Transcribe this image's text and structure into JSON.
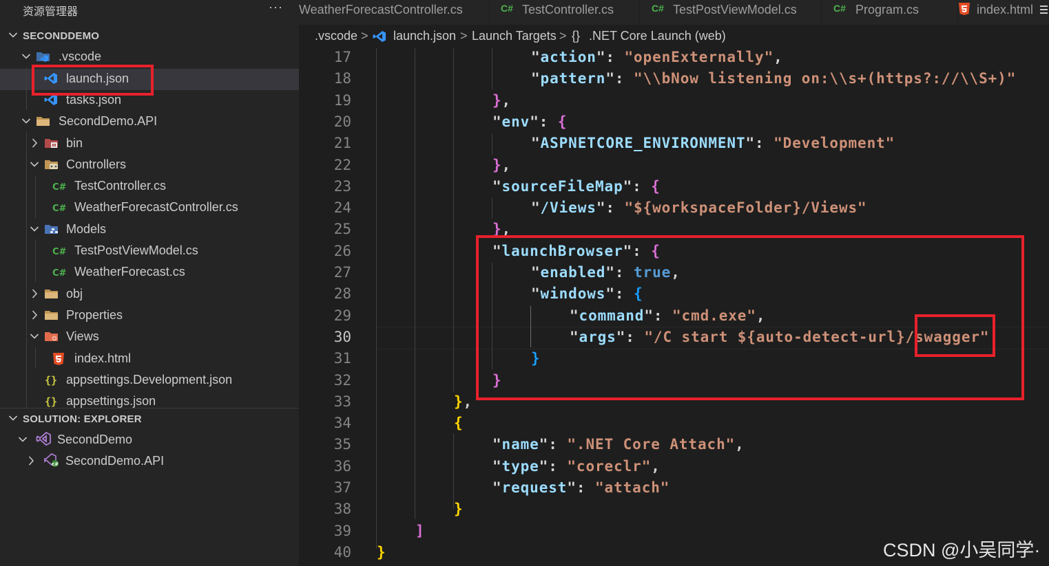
{
  "explorer": {
    "title": "资源管理器",
    "more": "···",
    "project_section": "SECONDDEMO",
    "tree": [
      {
        "label": ".vscode",
        "icon": "vscode-folder-icon",
        "expanded": true,
        "level": 1,
        "type": "folder"
      },
      {
        "label": "launch.json",
        "icon": "vscode-json-icon",
        "level": 2,
        "type": "file",
        "selected": true
      },
      {
        "label": "tasks.json",
        "icon": "vscode-json-icon",
        "level": 2,
        "type": "file"
      },
      {
        "label": "SecondDemo.API",
        "icon": "folder-icon",
        "expanded": true,
        "level": 1,
        "type": "folder"
      },
      {
        "label": "bin",
        "icon": "bin-folder-icon",
        "expanded": false,
        "level": 2,
        "type": "folder"
      },
      {
        "label": "Controllers",
        "icon": "controllers-folder-icon",
        "expanded": true,
        "level": 2,
        "type": "folder"
      },
      {
        "label": "TestController.cs",
        "icon": "csharp-icon",
        "level": 3,
        "type": "file"
      },
      {
        "label": "WeatherForecastController.cs",
        "icon": "csharp-icon",
        "level": 3,
        "type": "file"
      },
      {
        "label": "Models",
        "icon": "models-folder-icon",
        "expanded": true,
        "level": 2,
        "type": "folder"
      },
      {
        "label": "TestPostViewModel.cs",
        "icon": "csharp-icon",
        "level": 3,
        "type": "file"
      },
      {
        "label": "WeatherForecast.cs",
        "icon": "csharp-icon",
        "level": 3,
        "type": "file"
      },
      {
        "label": "obj",
        "icon": "folder-icon",
        "expanded": false,
        "level": 2,
        "type": "folder"
      },
      {
        "label": "Properties",
        "icon": "folder-icon",
        "expanded": false,
        "level": 2,
        "type": "folder"
      },
      {
        "label": "Views",
        "icon": "views-folder-icon",
        "expanded": true,
        "level": 2,
        "type": "folder"
      },
      {
        "label": "index.html",
        "icon": "html-icon",
        "level": 3,
        "type": "file"
      },
      {
        "label": "appsettings.Development.json",
        "icon": "json-braces-icon",
        "level": 2,
        "type": "file"
      },
      {
        "label": "appsettings.json",
        "icon": "json-braces-icon",
        "level": 2,
        "type": "file"
      }
    ],
    "solution_section": "SOLUTION: EXPLORER",
    "solution_tree": [
      {
        "label": "SecondDemo",
        "icon": "solution-icon",
        "expanded": true,
        "level": 1
      },
      {
        "label": "SecondDemo.API",
        "icon": "csproj-icon",
        "expanded": false,
        "level": 2
      }
    ]
  },
  "tabs": [
    {
      "label": "WeatherForecastController.cs",
      "icon": ""
    },
    {
      "label": "TestController.cs",
      "icon": "C#"
    },
    {
      "label": "TestPostViewModel.cs",
      "icon": "C#"
    },
    {
      "label": "Program.cs",
      "icon": "C#"
    },
    {
      "label": "index.html",
      "icon": "5"
    }
  ],
  "breadcrumb": {
    "folder": ".vscode",
    "file": "launch.json",
    "section": "Launch Targets",
    "braces": "{}",
    "item": ".NET Core Launch (web)",
    "separator": ">"
  },
  "editor": {
    "active_line": 30,
    "lines": [
      {
        "n": 17,
        "code": "\"action\": \"openExternally\","
      },
      {
        "n": 18,
        "code": "\"pattern\": \"\\\\bNow listening on:\\\\s+(https?://\\\\S+)\""
      },
      {
        "n": 19,
        "code": "},"
      },
      {
        "n": 20,
        "code": "\"env\": {"
      },
      {
        "n": 21,
        "code": "\"ASPNETCORE_ENVIRONMENT\": \"Development\""
      },
      {
        "n": 22,
        "code": "},"
      },
      {
        "n": 23,
        "code": "\"sourceFileMap\": {"
      },
      {
        "n": 24,
        "code": "\"/Views\": \"${workspaceFolder}/Views\""
      },
      {
        "n": 25,
        "code": "},"
      },
      {
        "n": 26,
        "code": "\"launchBrowser\": {"
      },
      {
        "n": 27,
        "code": "\"enabled\": true,"
      },
      {
        "n": 28,
        "code": "\"windows\": {"
      },
      {
        "n": 29,
        "code": "\"command\": \"cmd.exe\","
      },
      {
        "n": 30,
        "code": "\"args\": \"/C start ${auto-detect-url}/swagger\""
      },
      {
        "n": 31,
        "code": "}"
      },
      {
        "n": 32,
        "code": "}"
      },
      {
        "n": 33,
        "code": "},"
      },
      {
        "n": 34,
        "code": "{"
      },
      {
        "n": 35,
        "code": "\"name\": \".NET Core Attach\","
      },
      {
        "n": 36,
        "code": "\"type\": \"coreclr\","
      },
      {
        "n": 37,
        "code": "\"request\": \"attach\""
      },
      {
        "n": 38,
        "code": "}"
      },
      {
        "n": 39,
        "code": "]"
      },
      {
        "n": 40,
        "code": "}"
      }
    ]
  },
  "watermark": "CSDN @小吴同学·",
  "colors": {
    "highlight_box": "#e8212b",
    "json_key": "#9cdcfe",
    "json_string": "#ce9178",
    "json_keyword": "#569cd6",
    "csharp_icon": "#4db34d",
    "vscode_blue": "#3794ff"
  }
}
